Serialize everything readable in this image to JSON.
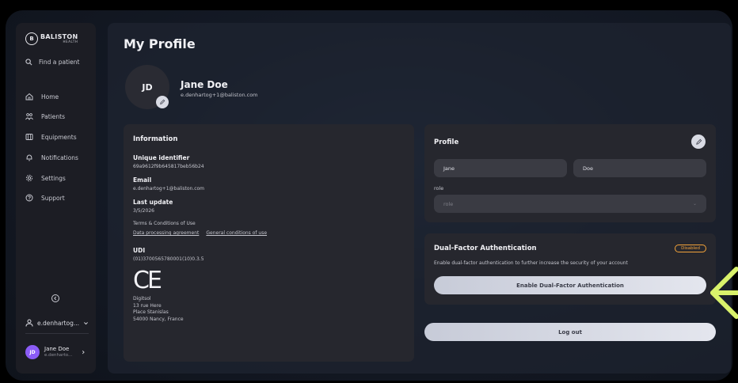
{
  "sidebar": {
    "logo_main": "BALISTON",
    "logo_sub": "HEALTH",
    "logo_initial": "B",
    "search_label": "Find a patient",
    "items": [
      {
        "label": "Home",
        "icon": "home-icon"
      },
      {
        "label": "Patients",
        "icon": "patients-icon"
      },
      {
        "label": "Equipments",
        "icon": "equipments-icon"
      },
      {
        "label": "Notifications",
        "icon": "bell-icon"
      },
      {
        "label": "Settings",
        "icon": "gear-icon"
      },
      {
        "label": "Support",
        "icon": "help-icon"
      }
    ],
    "account_label": "e.denhartog...",
    "user": {
      "initials": "JD",
      "name": "Jane Doe",
      "email": "e.denharto..."
    }
  },
  "page": {
    "title": "My Profile"
  },
  "user": {
    "initials": "JD",
    "name": "Jane Doe",
    "email": "e.denhartog+1@baliston.com"
  },
  "information": {
    "title": "Information",
    "unique_id_label": "Unique identifier",
    "unique_id_value": "69a9612f9b645817beb56b24",
    "email_label": "Email",
    "email_value": "e.denhartog+1@baliston.com",
    "last_update_label": "Last update",
    "last_update_value": "3/5/2026",
    "terms_label": "Terms & Conditions of Use",
    "link_data": "Data processing agreement",
    "link_general": "General conditions of use",
    "udi_label": "UDI",
    "udi_value": "(01)3700565780001(10)0.3.5",
    "ce_mark": "CE",
    "address": [
      "Digitsol",
      "13 rue Here",
      "Place Stanislas",
      "54000 Nancy, France"
    ]
  },
  "profile": {
    "title": "Profile",
    "first_name": "Jane",
    "last_name": "Doe",
    "role_label": "role",
    "role_placeholder": "role"
  },
  "twofa": {
    "title": "Dual-Factor Authentication",
    "status": "Disabled",
    "description": "Enable dual-factor authentication to further increase the security of your account",
    "button": "Enable Dual-Factor Authentication"
  },
  "logout": {
    "label": "Log out"
  },
  "colors": {
    "accent_badge": "#f2a23a",
    "avatar_purple": "#8b5cf6",
    "arrow_green": "#d9f26b"
  }
}
